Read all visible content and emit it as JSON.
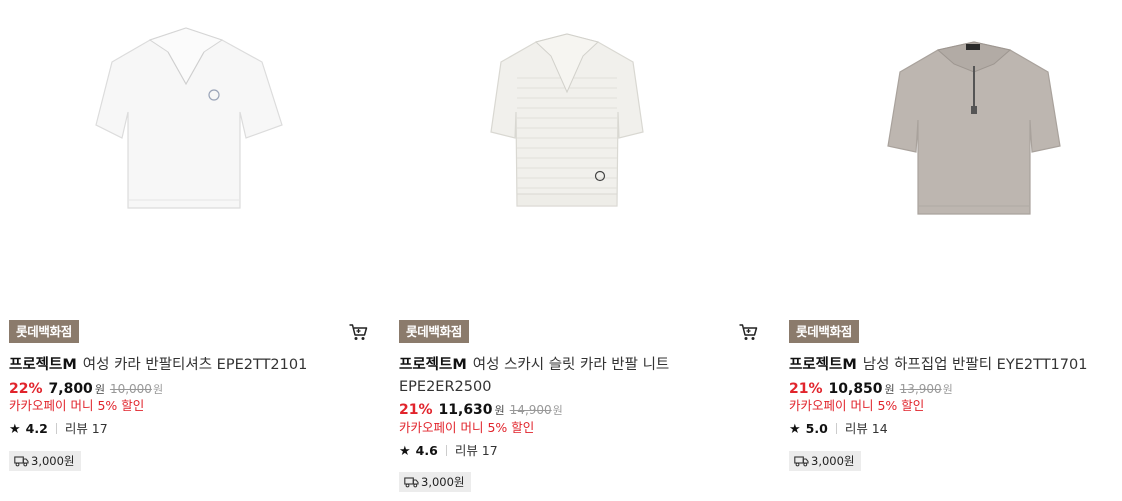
{
  "products": [
    {
      "store": "롯데백화점",
      "brand": "프로젝트M",
      "name": "여성 카라 반팔티셔츠 EPE2TT2101",
      "discount": "22%",
      "price": "7,800",
      "currency": "원",
      "original_price": "10,000",
      "promo": "카카오페이 머니 5% 할인",
      "rating": "4.2",
      "reviews": "리뷰 17",
      "shipping": "3,000원",
      "image": "white-collar-shirt"
    },
    {
      "store": "롯데백화점",
      "brand": "프로젝트M",
      "name": "여성 스카시 슬릿 카라 반팔 니트 EPE2ER2500",
      "discount": "21%",
      "price": "11,630",
      "currency": "원",
      "original_price": "14,900",
      "promo": "카카오페이 머니 5% 할인",
      "rating": "4.6",
      "reviews": "리뷰 17",
      "shipping": "3,000원",
      "image": "white-knit-polo"
    },
    {
      "store": "롯데백화점",
      "brand": "프로젝트M",
      "name": "남성 하프집업 반팔티 EYE2TT1701",
      "discount": "21%",
      "price": "10,850",
      "currency": "원",
      "original_price": "13,900",
      "promo": "카카오페이 머니 5% 할인",
      "rating": "5.0",
      "reviews": "리뷰 14",
      "shipping": "3,000원",
      "image": "grey-half-zip-tee"
    }
  ],
  "icons": {
    "cart": "cart-icon",
    "star": "star-icon",
    "delivery": "truck-icon"
  },
  "colors": {
    "badge": "#8b7b6c",
    "discount": "#e1242c",
    "promo": "#e1242c",
    "ship_bg": "#ececec"
  }
}
